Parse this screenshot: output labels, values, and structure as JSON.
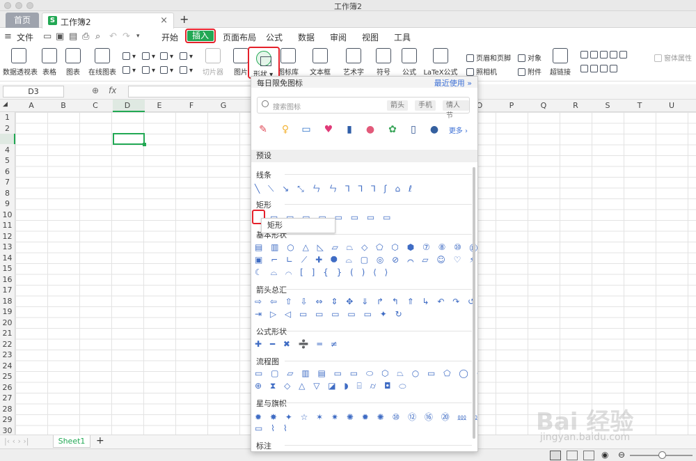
{
  "window": {
    "title": "工作簿2"
  },
  "tabs": {
    "home": "首页",
    "doc": "工作簿2",
    "close": "×",
    "plus": "+"
  },
  "menu": {
    "file": "文件",
    "items": [
      "开始",
      "插入",
      "页面布局",
      "公式",
      "数据",
      "审阅",
      "视图",
      "工具"
    ]
  },
  "ribbon": {
    "pivot": "数据透视表",
    "table": "表格",
    "chart": "图表",
    "online_chart": "在线图表",
    "slicer": "切片器",
    "picture": "图片",
    "shape": "形状",
    "iconlib": "图标库",
    "textbox": "文本框",
    "wordart": "艺术字",
    "symbol": "符号",
    "formula": "公式",
    "latex": "LaTeX公式",
    "header_footer": "页眉和页脚",
    "object": "对象",
    "camera": "照相机",
    "attachment": "附件",
    "hyperlink": "超链接",
    "form_props": "窗体属性"
  },
  "formula_bar": {
    "name_box": "D3",
    "fx": "fx",
    "value": ""
  },
  "columns": [
    "A",
    "B",
    "C",
    "D",
    "E",
    "F",
    "G",
    "",
    "",
    "",
    "",
    "",
    "",
    "",
    "O",
    "P",
    "Q",
    "R",
    "S",
    "T",
    "U"
  ],
  "rows": [
    "1",
    "2",
    "3",
    "4",
    "5",
    "6",
    "7",
    "8",
    "9",
    "10",
    "11",
    "12",
    "13",
    "14",
    "15",
    "16",
    "17",
    "18",
    "19",
    "20",
    "21",
    "22",
    "23",
    "24",
    "25",
    "26",
    "27",
    "28",
    "29",
    "30"
  ],
  "sheet_tab": "Sheet1",
  "panel": {
    "header": "每日限免图标",
    "recent": "最近使用",
    "search_placeholder": "搜索图标",
    "chips": [
      "箭头",
      "手机",
      "情人节"
    ],
    "more": "更多",
    "preset": "预设",
    "sections": [
      "线条",
      "矩形",
      "基本形状",
      "箭头总汇",
      "公式形状",
      "流程图",
      "星与旗帜",
      "标注"
    ],
    "tooltip": "矩形"
  },
  "watermark": {
    "main": "Bai 经验",
    "sub": "jingyan.baidu.com"
  }
}
